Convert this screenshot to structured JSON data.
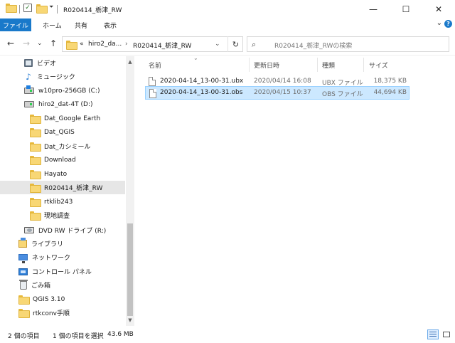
{
  "window": {
    "title": "R020414_栃津_RW",
    "minimize_label": "—",
    "maximize_label": "☐",
    "close_label": "✕"
  },
  "ribbon": {
    "file_tab": "ファイル",
    "tabs": [
      "ホーム",
      "共有",
      "表示"
    ],
    "expand_glyph": "⌄",
    "help_glyph": "?"
  },
  "address": {
    "overflow": "«",
    "crumbs": [
      "hiro2_da...",
      "R020414_栃津_RW"
    ],
    "separator": "›",
    "search_placeholder": "R020414_栃津_RWの検索"
  },
  "nav": {
    "items": [
      {
        "label": "ビデオ",
        "icon": "video-icon"
      },
      {
        "label": "ミュージック",
        "icon": "music-icon"
      },
      {
        "label": "w10pro-256GB (C:)",
        "icon": "drive-icon"
      },
      {
        "label": "hiro2_dat-4T (D:)",
        "icon": "drive-icon"
      },
      {
        "label": "Dat_Google Earth",
        "icon": "folder-icon"
      },
      {
        "label": "Dat_QGIS",
        "icon": "folder-icon"
      },
      {
        "label": "Dat_カシミール",
        "icon": "folder-icon"
      },
      {
        "label": "Download",
        "icon": "folder-icon"
      },
      {
        "label": "Hayato",
        "icon": "folder-icon"
      },
      {
        "label": "R020414_栃津_RW",
        "icon": "folder-icon"
      },
      {
        "label": "rtklib243",
        "icon": "folder-icon"
      },
      {
        "label": "現地調査",
        "icon": "folder-icon"
      },
      {
        "label": "DVD RW ドライブ (R:)",
        "icon": "dvd-icon"
      },
      {
        "label": "ライブラリ",
        "icon": "library-icon"
      },
      {
        "label": "ネットワーク",
        "icon": "network-icon"
      },
      {
        "label": "コントロール パネル",
        "icon": "control-panel-icon"
      },
      {
        "label": "ごみ箱",
        "icon": "recycle-bin-icon"
      },
      {
        "label": "QGIS 3.10",
        "icon": "folder-icon"
      },
      {
        "label": "rtkconv手順",
        "icon": "folder-icon"
      }
    ]
  },
  "columns": {
    "name": "名前",
    "modified": "更新日時",
    "type": "種類",
    "size": "サイズ"
  },
  "files": [
    {
      "name": "2020-04-14_13-00-31.ubx",
      "modified": "2020/04/14 16:08",
      "type": "UBX ファイル",
      "size": "18,375 KB"
    },
    {
      "name": "2020-04-14_13-00-31.obs",
      "modified": "2020/04/15 10:37",
      "type": "OBS ファイル",
      "size": "44,694 KB"
    }
  ],
  "status": {
    "item_count": "2 個の項目",
    "selection": "1 個の項目を選択",
    "selection_size": "43.6 MB"
  },
  "colors": {
    "accent": "#1979ca",
    "selected_row": "#cce8ff",
    "selected_nav": "#e6e6e6",
    "folder": "#f8d775"
  }
}
